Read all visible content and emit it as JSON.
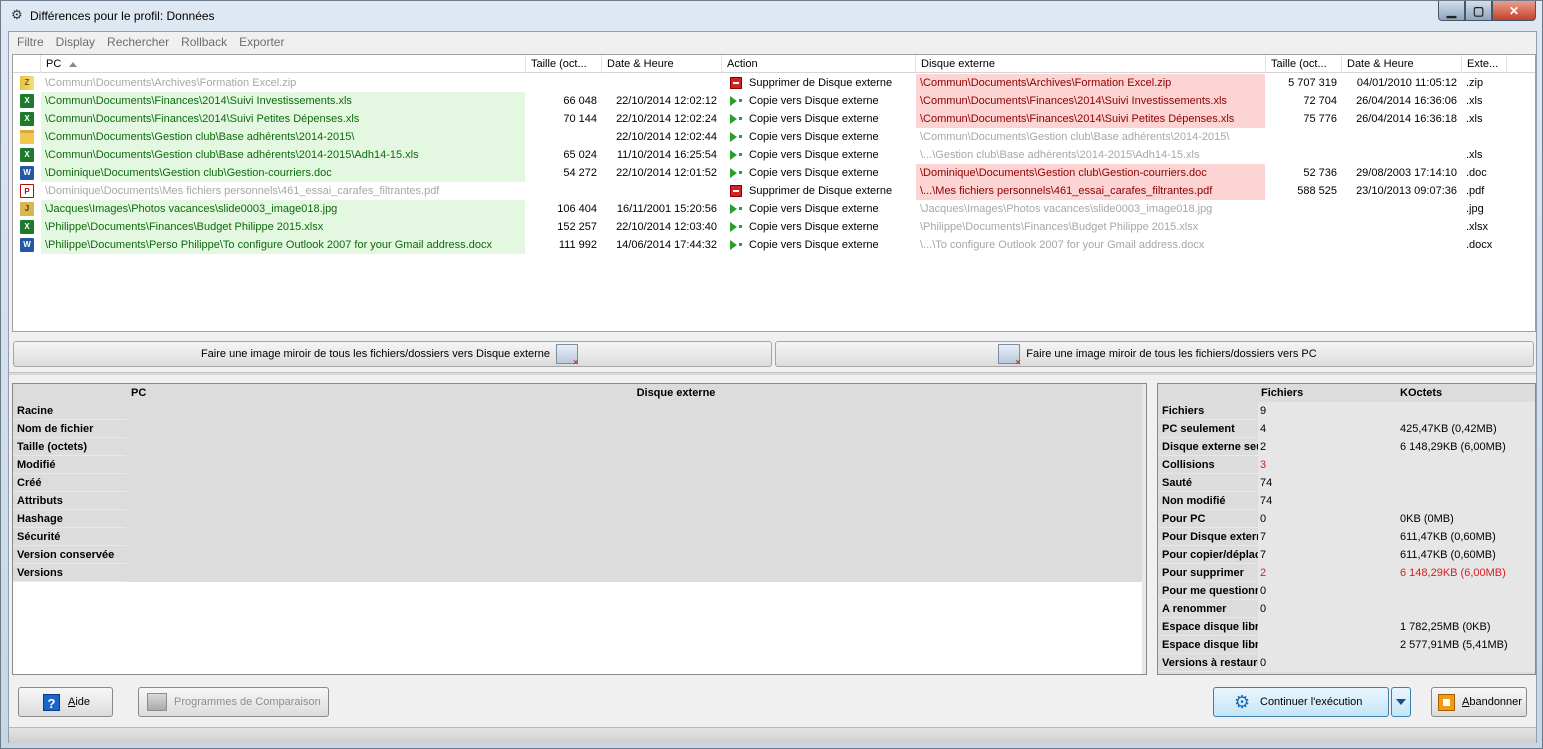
{
  "window": {
    "title": "Différences pour le profil: Données"
  },
  "menu": [
    "Filtre",
    "Display",
    "Rechercher",
    "Rollback",
    "Exporter"
  ],
  "grid": {
    "columns": {
      "pc": "PC",
      "size": "Taille (oct...",
      "date": "Date & Heure",
      "action": "Action",
      "ext": "Disque externe",
      "xsize": "Taille (oct...",
      "xdate": "Date & Heure",
      "xext": "Exte..."
    },
    "rows": [
      {
        "icon": "zip-icon",
        "pc": "\\Commun\\Documents\\Archives\\Formation Excel.zip",
        "pc_style": "grey",
        "size": "",
        "date": "",
        "action_icon": "delete",
        "action": "Supprimer de Disque externe",
        "ext": "\\Commun\\Documents\\Archives\\Formation Excel.zip",
        "ext_style": "red",
        "xsize": "5 707 319",
        "xdate": "04/01/2010 11:05:12",
        "xext": ".zip"
      },
      {
        "icon": "xls-icon",
        "pc": "\\Commun\\Documents\\Finances\\2014\\Suivi Investissements.xls",
        "pc_style": "green",
        "size": "66 048",
        "date": "22/10/2014 12:02:12",
        "action_icon": "copy",
        "action": "Copie vers Disque externe",
        "ext": "\\Commun\\Documents\\Finances\\2014\\Suivi Investissements.xls",
        "ext_style": "red",
        "xsize": "72 704",
        "xdate": "26/04/2014 16:36:06",
        "xext": ".xls"
      },
      {
        "icon": "xls-icon",
        "pc": "\\Commun\\Documents\\Finances\\2014\\Suivi Petites Dépenses.xls",
        "pc_style": "green",
        "size": "70 144",
        "date": "22/10/2014 12:02:24",
        "action_icon": "copy",
        "action": "Copie vers Disque externe",
        "ext": "\\Commun\\Documents\\Finances\\2014\\Suivi Petites Dépenses.xls",
        "ext_style": "red",
        "xsize": "75 776",
        "xdate": "26/04/2014 16:36:18",
        "xext": ".xls"
      },
      {
        "icon": "folder-icon",
        "pc": "\\Commun\\Documents\\Gestion club\\Base adhérents\\2014-2015\\",
        "pc_style": "green",
        "size": "",
        "date": "22/10/2014 12:02:44",
        "action_icon": "copy",
        "action": "Copie vers Disque externe",
        "ext": "\\Commun\\Documents\\Gestion club\\Base adhérents\\2014-2015\\",
        "ext_style": "grey",
        "xsize": "",
        "xdate": "",
        "xext": ""
      },
      {
        "icon": "xls-icon",
        "pc": "\\Commun\\Documents\\Gestion club\\Base adhérents\\2014-2015\\Adh14-15.xls",
        "pc_style": "green",
        "size": "65 024",
        "date": "11/10/2014 16:25:54",
        "action_icon": "copy",
        "action": "Copie vers Disque externe",
        "ext": "\\...\\Gestion club\\Base adhérents\\2014-2015\\Adh14-15.xls",
        "ext_style": "grey",
        "xsize": "",
        "xdate": "",
        "xext": ".xls"
      },
      {
        "icon": "doc-icon",
        "pc": "\\Dominique\\Documents\\Gestion club\\Gestion-courriers.doc",
        "pc_style": "green",
        "size": "54 272",
        "date": "22/10/2014 12:01:52",
        "action_icon": "copy",
        "action": "Copie vers Disque externe",
        "ext": "\\Dominique\\Documents\\Gestion club\\Gestion-courriers.doc",
        "ext_style": "red",
        "xsize": "52 736",
        "xdate": "29/08/2003 17:14:10",
        "xext": ".doc"
      },
      {
        "icon": "pdf-icon",
        "pc": "\\Dominique\\Documents\\Mes fichiers personnels\\461_essai_carafes_filtrantes.pdf",
        "pc_style": "grey",
        "size": "",
        "date": "",
        "action_icon": "delete",
        "action": "Supprimer de Disque externe",
        "ext": "\\...\\Mes fichiers personnels\\461_essai_carafes_filtrantes.pdf",
        "ext_style": "red",
        "xsize": "588 525",
        "xdate": "23/10/2013 09:07:36",
        "xext": ".pdf"
      },
      {
        "icon": "jpg-icon",
        "pc": "\\Jacques\\Images\\Photos vacances\\slide0003_image018.jpg",
        "pc_style": "green",
        "size": "106 404",
        "date": "16/11/2001 15:20:56",
        "action_icon": "copy",
        "action": "Copie vers Disque externe",
        "ext": "\\Jacques\\Images\\Photos vacances\\slide0003_image018.jpg",
        "ext_style": "grey",
        "xsize": "",
        "xdate": "",
        "xext": ".jpg"
      },
      {
        "icon": "xls-icon",
        "pc": "\\Philippe\\Documents\\Finances\\Budget Philippe 2015.xlsx",
        "pc_style": "green",
        "size": "152 257",
        "date": "22/10/2014 12:03:40",
        "action_icon": "copy",
        "action": "Copie vers Disque externe",
        "ext": "\\Philippe\\Documents\\Finances\\Budget Philippe 2015.xlsx",
        "ext_style": "grey",
        "xsize": "",
        "xdate": "",
        "xext": ".xlsx"
      },
      {
        "icon": "doc-icon",
        "pc": "\\Philippe\\Documents\\Perso Philippe\\To configure Outlook 2007 for your Gmail address.docx",
        "pc_style": "green",
        "size": "111 992",
        "date": "14/06/2014 17:44:32",
        "action_icon": "copy",
        "action": "Copie vers Disque externe",
        "ext": "\\...\\To configure Outlook 2007 for your Gmail address.docx",
        "ext_style": "grey",
        "xsize": "",
        "xdate": "",
        "xext": ".docx"
      }
    ]
  },
  "mirror": {
    "to_external": "Faire une image miroir de tous les fichiers/dossiers vers Disque externe",
    "to_pc": "Faire une image miroir de tous les fichiers/dossiers vers PC"
  },
  "details": {
    "col_pc": "PC",
    "col_ext": "Disque externe",
    "labels": [
      "Racine",
      "Nom de fichier",
      "Taille (octets)",
      "Modifié",
      "Créé",
      "Attributs",
      "Hashage",
      "Sécurité",
      "Version conservée",
      "Versions"
    ]
  },
  "stats": {
    "col_files": "Fichiers",
    "col_kb": "KOctets",
    "rows": [
      {
        "label": "Fichiers",
        "files": "9",
        "kb": "",
        "red": false
      },
      {
        "label": "PC seulement",
        "files": "4",
        "kb": "425,47KB (0,42MB)",
        "red": false
      },
      {
        "label": "Disque externe seulement",
        "files": "2",
        "kb": "6 148,29KB (6,00MB)",
        "red": false
      },
      {
        "label": "Collisions",
        "files": "3",
        "kb": "",
        "red": true
      },
      {
        "label": "Sauté",
        "files": "74",
        "kb": "",
        "red": false
      },
      {
        "label": "Non modifié",
        "files": "74",
        "kb": "",
        "red": false
      },
      {
        "label": "Pour PC",
        "files": "0",
        "kb": "0KB (0MB)",
        "red": false
      },
      {
        "label": "Pour Disque externe",
        "files": "7",
        "kb": "611,47KB (0,60MB)",
        "red": false
      },
      {
        "label": "Pour copier/déplacer",
        "files": "7",
        "kb": "611,47KB (0,60MB)",
        "red": false
      },
      {
        "label": "Pour supprimer",
        "files": "2",
        "kb": "6 148,29KB (6,00MB)",
        "red": true
      },
      {
        "label": "Pour me questionner",
        "files": "0",
        "kb": "",
        "red": false
      },
      {
        "label": "A renommer",
        "files": "0",
        "kb": "",
        "red": false
      },
      {
        "label": "Espace disque libre",
        "files": "",
        "kb": "1 782,25MB (0KB)",
        "red": false
      },
      {
        "label": "Espace disque libre",
        "files": "",
        "kb": "2 577,91MB (5,41MB)",
        "red": false
      },
      {
        "label": "Versions à restaurer",
        "files": "0",
        "kb": "",
        "red": false
      }
    ]
  },
  "buttons": {
    "help_prefix": "A",
    "help_rest": "ide",
    "compare": "Programmes de Comparaison",
    "continue": "Continuer l'exécution",
    "abort_prefix": "A",
    "abort_rest": "bandonner"
  },
  "colors": {
    "green_bg": "#e4f8e1",
    "red_bg": "#fcd4d4",
    "accent": "#1c6bb8"
  }
}
